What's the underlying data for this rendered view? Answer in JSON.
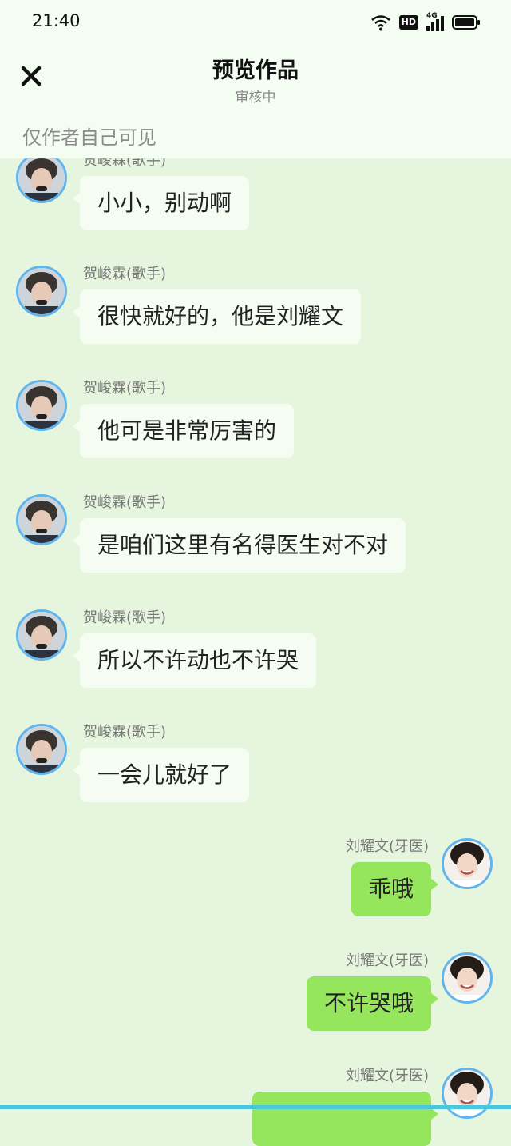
{
  "status_bar": {
    "time": "21:40",
    "hd_label": "HD",
    "network_label": "4G"
  },
  "header": {
    "title": "预览作品",
    "subtitle": "审核中",
    "visibility_note": "仅作者自己可见"
  },
  "messages": [
    {
      "side": "left",
      "name": "贺峻霖(歌手)",
      "text": "小小，别动啊"
    },
    {
      "side": "left",
      "name": "贺峻霖(歌手)",
      "text": "很快就好的，他是刘耀文"
    },
    {
      "side": "left",
      "name": "贺峻霖(歌手)",
      "text": "他可是非常厉害的"
    },
    {
      "side": "left",
      "name": "贺峻霖(歌手)",
      "text": "是咱们这里有名得医生对不对"
    },
    {
      "side": "left",
      "name": "贺峻霖(歌手)",
      "text": "所以不许动也不许哭"
    },
    {
      "side": "left",
      "name": "贺峻霖(歌手)",
      "text": "一会儿就好了"
    },
    {
      "side": "right",
      "name": "刘耀文(牙医)",
      "text": "乖哦"
    },
    {
      "side": "right",
      "name": "刘耀文(牙医)",
      "text": "不许哭哦"
    },
    {
      "side": "right",
      "name": "刘耀文(牙医)",
      "text": ""
    }
  ],
  "colors": {
    "background": "#e6f5de",
    "left_bubble": "#f5fdf3",
    "right_bubble": "#96e65d",
    "avatar_ring": "#60b5ee"
  }
}
